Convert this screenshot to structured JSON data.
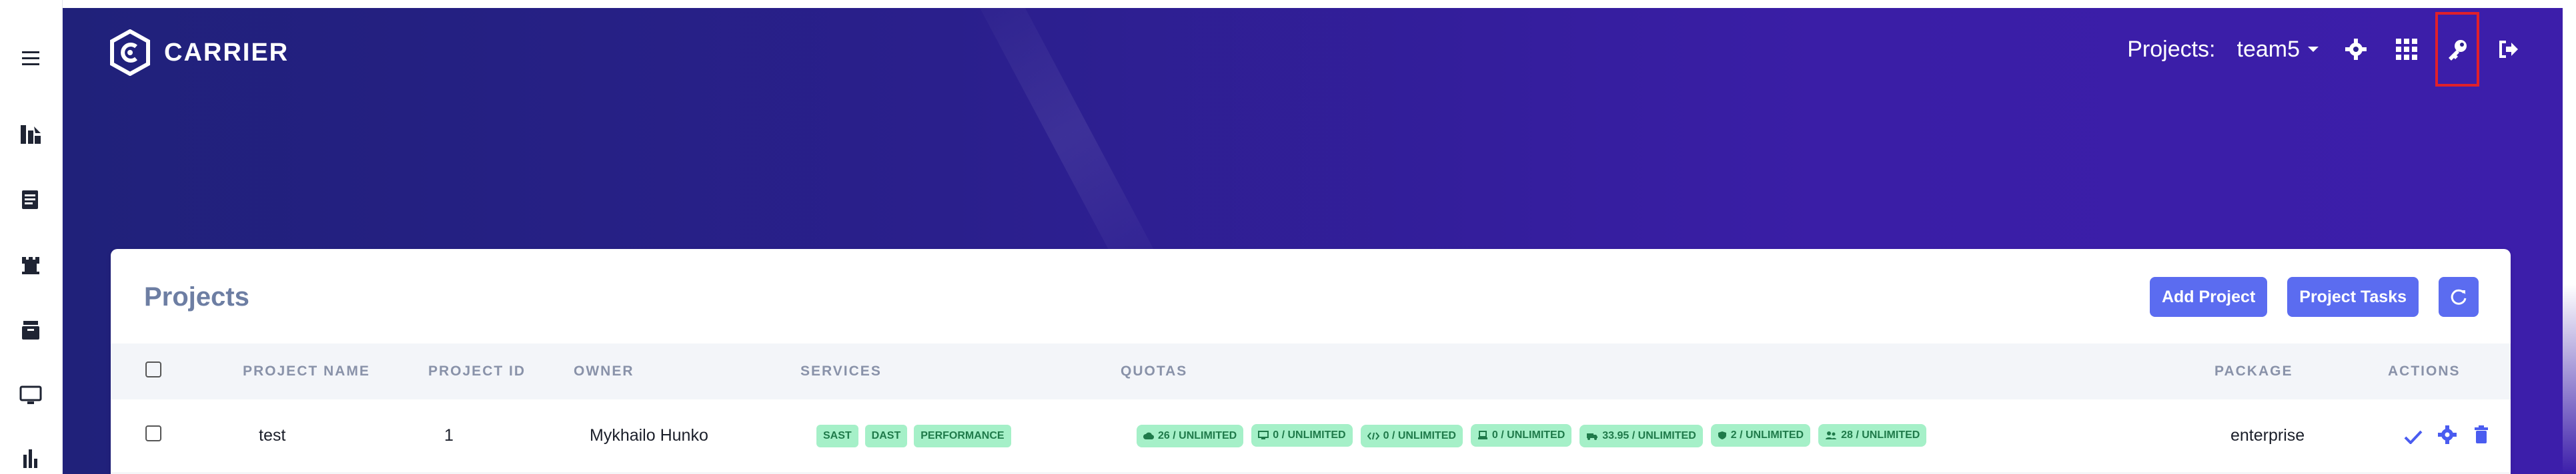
{
  "app": {
    "brand": "CARRIER"
  },
  "sidebar": {
    "items": [
      {
        "icon": "menu-icon"
      },
      {
        "icon": "dashboard-icon"
      },
      {
        "icon": "reports-icon"
      },
      {
        "icon": "castle-icon"
      },
      {
        "icon": "archive-icon"
      },
      {
        "icon": "monitor-icon"
      },
      {
        "icon": "chart-icon"
      }
    ]
  },
  "topnav": {
    "projects_label": "Projects:",
    "project_value": "team5",
    "icons": [
      "gear-icon",
      "grid-icon",
      "key-icon",
      "logout-icon"
    ]
  },
  "card": {
    "title": "Projects",
    "add_project": "Add Project",
    "project_tasks": "Project Tasks"
  },
  "table": {
    "headers": [
      "PROJECT NAME",
      "PROJECT ID",
      "OWNER",
      "SERVICES",
      "QUOTAS",
      "PACKAGE",
      "ACTIONS"
    ],
    "rows": [
      {
        "name": "test",
        "id": "1",
        "owner": "Mykhailo Hunko",
        "services": [
          "SAST",
          "DAST",
          "PERFORMANCE"
        ],
        "quotas": [
          {
            "icon": "cloud-icon",
            "text": "26 / UNLIMITED"
          },
          {
            "icon": "desktop-icon",
            "text": "0 / UNLIMITED"
          },
          {
            "icon": "code-icon",
            "text": "0 / UNLIMITED"
          },
          {
            "icon": "laptop-icon",
            "text": "0 / UNLIMITED"
          },
          {
            "icon": "truck-icon",
            "text": "33.95 / UNLIMITED"
          },
          {
            "icon": "shield-icon",
            "text": "2 / UNLIMITED"
          },
          {
            "icon": "users-icon",
            "text": "28 / UNLIMITED"
          }
        ],
        "package": "enterprise"
      }
    ]
  },
  "colors": {
    "hero_start": "#20217a",
    "hero_end": "#3c1eaa",
    "primary_button": "#5b6cf0",
    "tag_bg": "#a5f0c8",
    "tag_text": "#1f7a4a",
    "highlight": "#e0202a"
  }
}
